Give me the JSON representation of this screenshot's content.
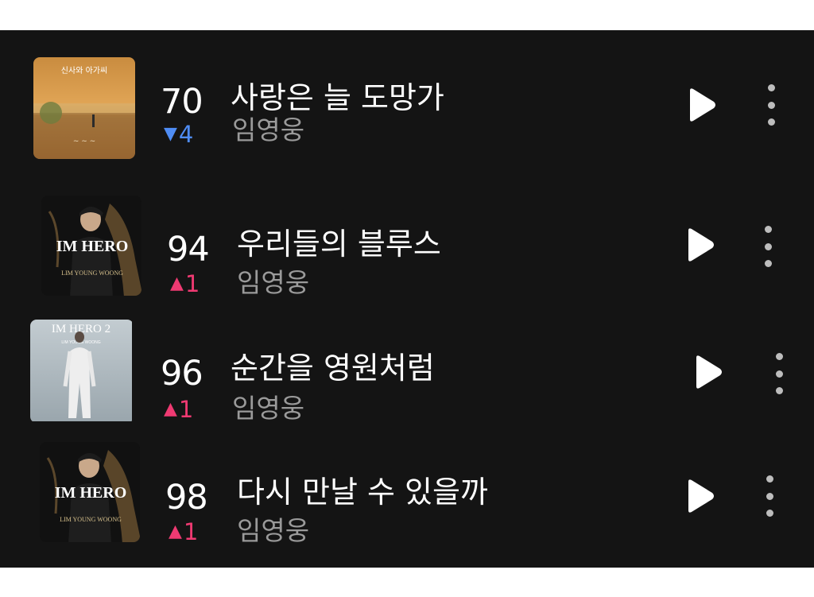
{
  "songs": [
    {
      "rank": "70",
      "title": "사랑은 늘 도망가",
      "change_symbol": "▼",
      "change_value": "4",
      "change_dir": "down",
      "artist": "임영웅",
      "cover": "drama-ost-sunset"
    },
    {
      "rank": "94",
      "title": "우리들의 블루스",
      "change_symbol": "▲",
      "change_value": "1",
      "change_dir": "up",
      "artist": "임영웅",
      "cover": "im-hero-dark"
    },
    {
      "rank": "96",
      "title": "순간을 영원처럼",
      "change_symbol": "▲",
      "change_value": "1",
      "change_dir": "up",
      "artist": "임영웅",
      "cover": "im-hero-2-light"
    },
    {
      "rank": "98",
      "title": "다시 만날 수 있을까",
      "change_symbol": "▲",
      "change_value": "1",
      "change_dir": "up",
      "artist": "임영웅",
      "cover": "im-hero-dark"
    }
  ],
  "covers": {
    "drama_title_text": "신사와 아가씨",
    "im_hero_text": "IM HERO",
    "im_hero_2_text": "IM HERO 2"
  },
  "colors": {
    "background": "#141414",
    "rank_up": "#ef3a72",
    "rank_down": "#4f8df5",
    "artist": "#9a9a9a"
  },
  "icons": {
    "play": "play-icon",
    "more": "more-vertical-icon"
  }
}
